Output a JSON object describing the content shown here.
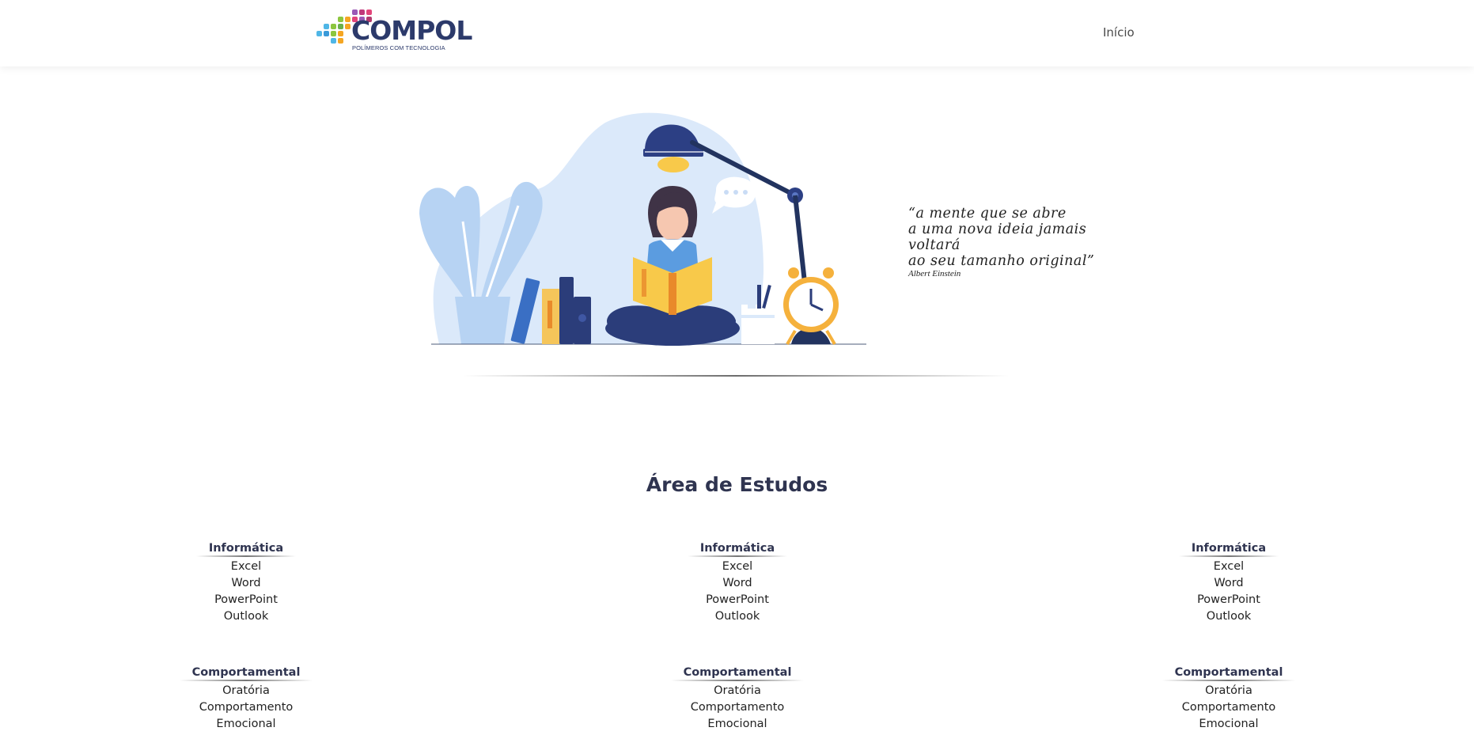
{
  "brand": {
    "name": "COMPOL",
    "tagline": "POLÍMEROS COM TECNOLOGIA",
    "dot_colors": [
      "#4fb6e6",
      "#8cc63e",
      "#f5a623",
      "#e2457a",
      "#9b59b6",
      "#2c3a6b"
    ]
  },
  "nav": {
    "home_label": "Início"
  },
  "hero": {
    "illustration": "woman-reading-book-illustration",
    "quote_lines": [
      "“a mente que se abre",
      "a uma nova ideia jamais",
      "voltará",
      "ao seu tamanho original”"
    ],
    "quote_author": "Albert Einstein"
  },
  "section": {
    "title": "Área de Estudos"
  },
  "columns": [
    {
      "groups": [
        {
          "title": "Informática",
          "items": [
            "Excel",
            "Word",
            "PowerPoint",
            "Outlook"
          ]
        },
        {
          "title": "Comportamental",
          "items": [
            "Oratória",
            "Comportamento",
            "Emocional"
          ]
        }
      ]
    },
    {
      "groups": [
        {
          "title": "Informática",
          "items": [
            "Excel",
            "Word",
            "PowerPoint",
            "Outlook"
          ]
        },
        {
          "title": "Comportamental",
          "items": [
            "Oratória",
            "Comportamento",
            "Emocional"
          ]
        }
      ]
    },
    {
      "groups": [
        {
          "title": "Informática",
          "items": [
            "Excel",
            "Word",
            "PowerPoint",
            "Outlook"
          ]
        },
        {
          "title": "Comportamental",
          "items": [
            "Oratória",
            "Comportamento",
            "Emocional"
          ]
        }
      ]
    }
  ]
}
